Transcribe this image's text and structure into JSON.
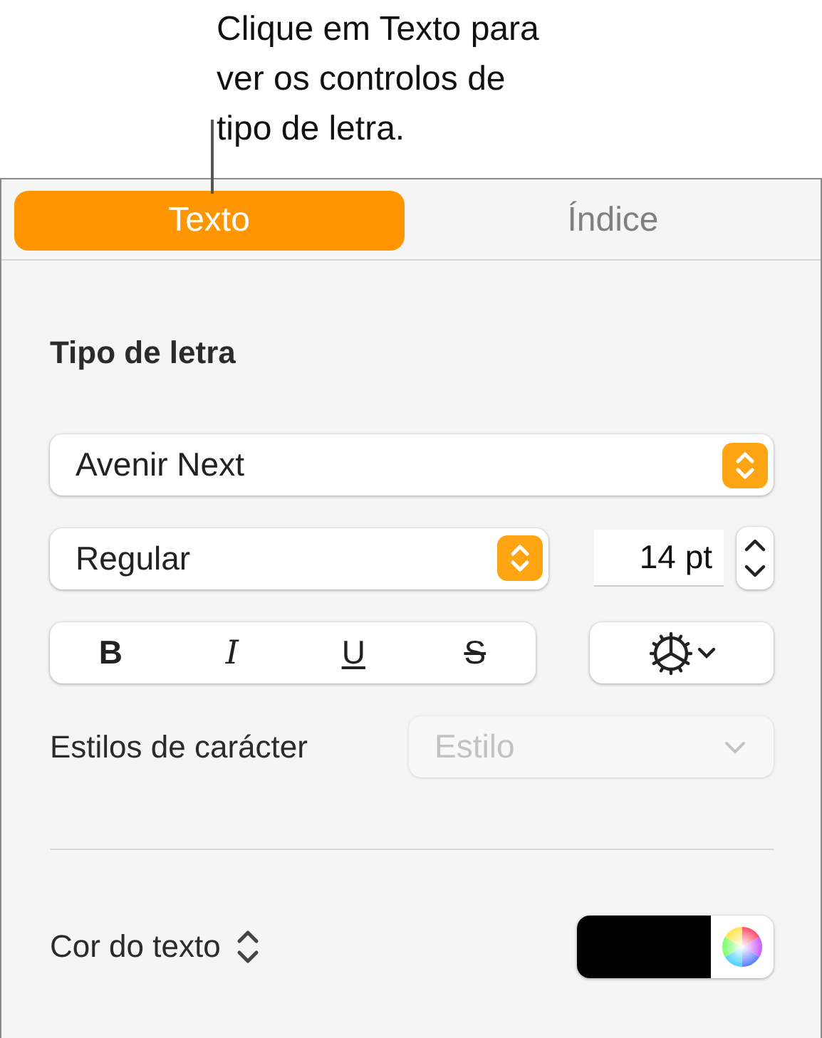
{
  "callout": {
    "text": "Clique em Texto para ver os controlos de tipo de letra."
  },
  "tabs": [
    {
      "label": "Texto",
      "selected": true
    },
    {
      "label": "Índice",
      "selected": false
    }
  ],
  "font_section": {
    "heading": "Tipo de letra",
    "font_family": "Avenir Next",
    "typeface": "Regular",
    "size": "14 pt",
    "style_buttons": [
      {
        "label": "B",
        "kind": "bold"
      },
      {
        "label": "I",
        "kind": "italic"
      },
      {
        "label": "U",
        "kind": "underline"
      },
      {
        "label": "S",
        "kind": "strikethrough"
      }
    ],
    "character_styles": {
      "label": "Estilos de carácter",
      "placeholder": "Estilo",
      "disabled": true
    }
  },
  "text_color": {
    "label": "Cor do texto",
    "color": "#000000"
  }
}
